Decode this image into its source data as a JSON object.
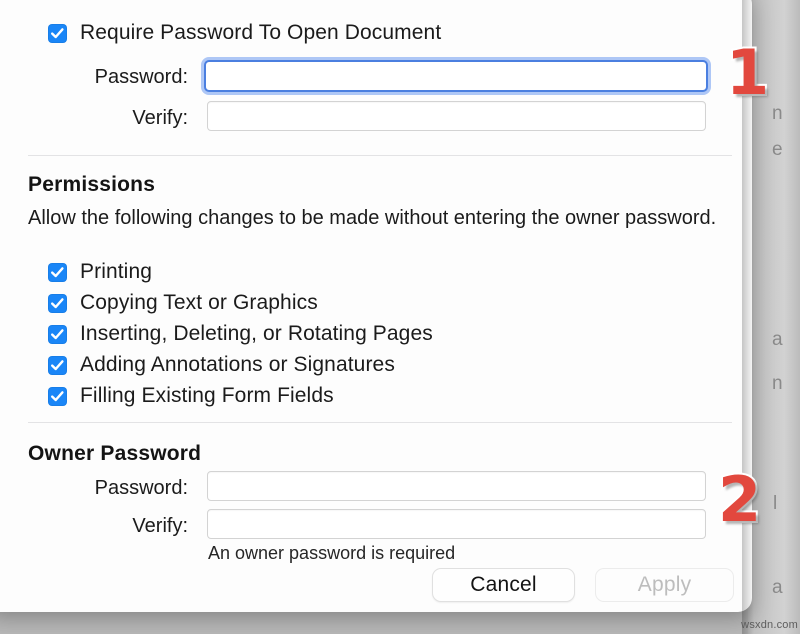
{
  "dialog": {
    "open_password": {
      "checkbox_label": "Require Password To Open Document",
      "checked": true,
      "password_label": "Password:",
      "password_value": "",
      "password_focused": true,
      "verify_label": "Verify:",
      "verify_value": ""
    },
    "permissions": {
      "title": "Permissions",
      "description": "Allow the following changes to be made without entering the owner password.",
      "items": [
        {
          "label": "Printing",
          "checked": true
        },
        {
          "label": "Copying Text or Graphics",
          "checked": true
        },
        {
          "label": "Inserting, Deleting, or Rotating Pages",
          "checked": true
        },
        {
          "label": "Adding Annotations or Signatures",
          "checked": true
        },
        {
          "label": "Filling Existing Form Fields",
          "checked": true
        }
      ]
    },
    "owner_password": {
      "title": "Owner Password",
      "password_label": "Password:",
      "password_value": "",
      "verify_label": "Verify:",
      "verify_value": "",
      "hint": "An owner password is required"
    },
    "buttons": {
      "cancel": "Cancel",
      "apply": "Apply",
      "apply_disabled": true
    }
  },
  "annotations": [
    {
      "number": "1"
    },
    {
      "number": "2"
    }
  ],
  "background": {
    "letters": [
      "n",
      "e",
      "a",
      "n",
      "l",
      "a"
    ],
    "watermark": "wsxdn.com"
  },
  "colors": {
    "accent_blue": "#1a86f7",
    "focus_ring": "#4b7fe0",
    "annotation_red": "#e2483e",
    "sheet_bg": "#fdfdfd",
    "desktop_bg": "#b8b8b8"
  }
}
